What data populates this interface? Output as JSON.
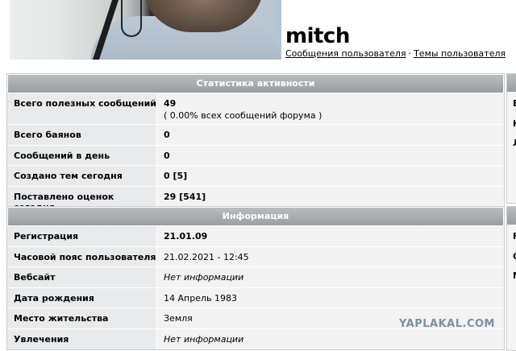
{
  "profile": {
    "username": "mitch",
    "link_posts": "Сообщения пользователя",
    "separator": "·",
    "link_topics": "Темы пользователя"
  },
  "activity": {
    "title": "Статистика активности",
    "rows": [
      {
        "label": "Всего полезных сообщений",
        "value": "49",
        "sub": "( 0.00% всех сообщений форума )"
      },
      {
        "label": "Всего баянов",
        "value": "0"
      },
      {
        "label": "Сообщений в день",
        "value": "0"
      },
      {
        "label": "Создано тем сегодня",
        "value": "0 [5]"
      },
      {
        "label": "Поставлено оценок сегодня",
        "value": "29 [541]"
      }
    ]
  },
  "info": {
    "title": "Информация",
    "rows": [
      {
        "label": "Регистрация",
        "value": "21.01.09"
      },
      {
        "label": "Часовой пояс пользователя",
        "value": "21.02.2021 - 12:45"
      },
      {
        "label": "Вебсайт",
        "value": "Нет информации"
      },
      {
        "label": "Дата рождения",
        "value": "14 Апрель 1983"
      },
      {
        "label": "Место жительства",
        "value": "Земля"
      },
      {
        "label": "Увлечения",
        "value": "Нет информации"
      }
    ]
  },
  "right_column_letters": {
    "top": [
      "E",
      "H",
      "Л"
    ],
    "bottom": [
      "F",
      "C",
      "M"
    ]
  },
  "watermark": "YAPLAKAL.COM"
}
